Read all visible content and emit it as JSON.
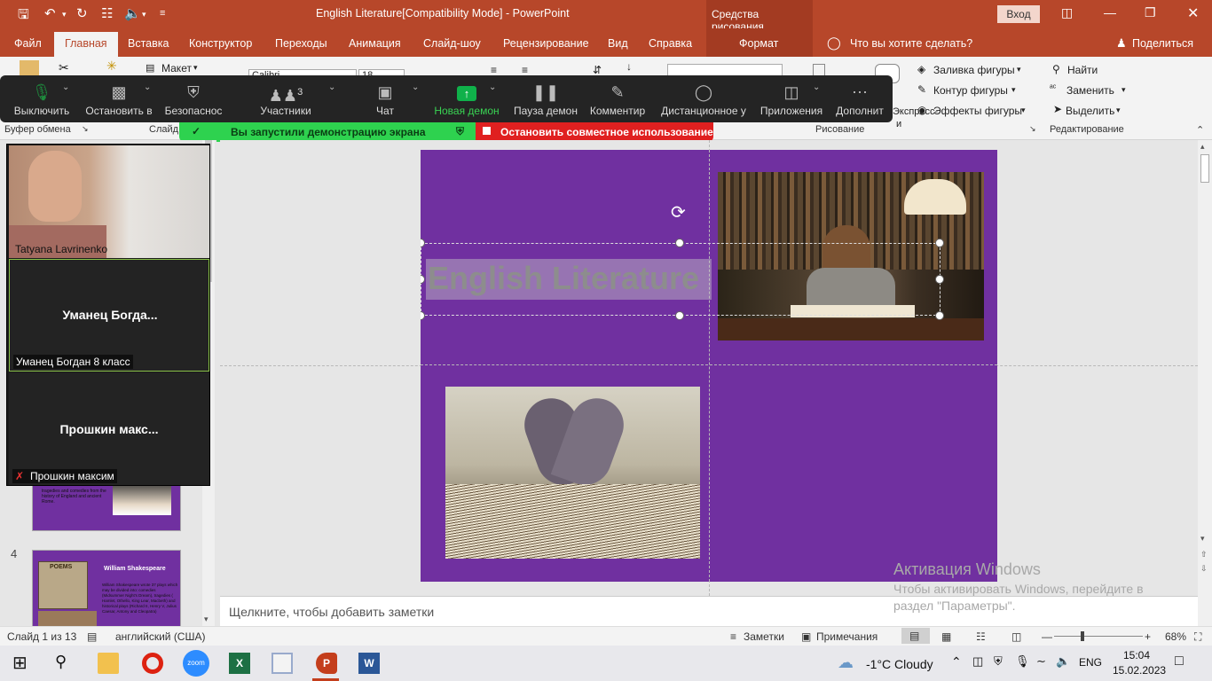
{
  "titlebar": {
    "title": "English Literature[Compatibility Mode]  -  PowerPoint",
    "context_tab": "Средства рисования",
    "login": "Вход"
  },
  "tabs": [
    "Файл",
    "Главная",
    "Вставка",
    "Конструктор",
    "Переходы",
    "Анимация",
    "Слайд-шоу",
    "Рецензирование",
    "Вид",
    "Справка"
  ],
  "format_tab": "Формат",
  "tell_me": "Что вы хотите сделать?",
  "share": "Поделиться",
  "ribbon": {
    "layout": "Макет",
    "font_name": "Calibri",
    "font_size": "18",
    "clipboard_group": "Буфер обмена",
    "slides_group": "Слайд",
    "drawing_group": "Рисование",
    "editing_group": "Редактирование",
    "express": "Экспресс-",
    "styles_short": "и",
    "shape_fill": "Заливка фигуры",
    "shape_outline": "Контур фигуры",
    "shape_effects": "Эффекты фигуры",
    "find": "Найти",
    "replace": "Заменить",
    "select": "Выделить"
  },
  "zoom": {
    "mute": "Выключить",
    "stop_video": "Остановить в",
    "security": "Безопаснос",
    "participants": "Участники",
    "participants_count": "3",
    "chat": "Чат",
    "new_share": "Новая демон",
    "pause_share": "Пауза демон",
    "annotate": "Комментир",
    "remote": "Дистанционное у",
    "apps": "Приложения",
    "more": "Дополнит",
    "share_banner": "Вы запустили демонстрацию экрана",
    "stop_share": "Остановить совместное использование"
  },
  "participants": [
    {
      "name": "Tatyana Lavrinenko",
      "center": ""
    },
    {
      "name": "Уманец Богдан 8 класс",
      "center": "Уманец  Богда..."
    },
    {
      "name": "Прошкин максим",
      "center": "Прошкин  макс..."
    }
  ],
  "thumbnails": {
    "slide3_text": "tragedies and comedies from the history of England and ancient Rome.",
    "slide4_number": "4",
    "slide4_title": "William Shakespeare",
    "slide4_text": "William Shakespeare wrote 37 plays which may be divided into: comedies (Midsummer Night's Dream), tragedies ( Hamlet, Othello, King Lear, Macbeth) and historical plays (Richard II, Henry V, Julius Caesar, Antony and Cleopatra)",
    "slide4_book": "POEMS"
  },
  "slide": {
    "title": "English Literature"
  },
  "notes_placeholder": "Щелкните, чтобы добавить заметки",
  "activation": {
    "title": "Активация Windows",
    "line1": "Чтобы активировать Windows, перейдите в",
    "line2": "раздел \"Параметры\"."
  },
  "status": {
    "slide": "Слайд 1 из 13",
    "language": "английский (США)",
    "notes": "Заметки",
    "comments": "Примечания",
    "zoom": "68%"
  },
  "taskbar": {
    "weather": "-1°C  Cloudy",
    "lang": "ENG",
    "time": "15:04",
    "date": "15.02.2023",
    "zoom_app": "zoom"
  }
}
